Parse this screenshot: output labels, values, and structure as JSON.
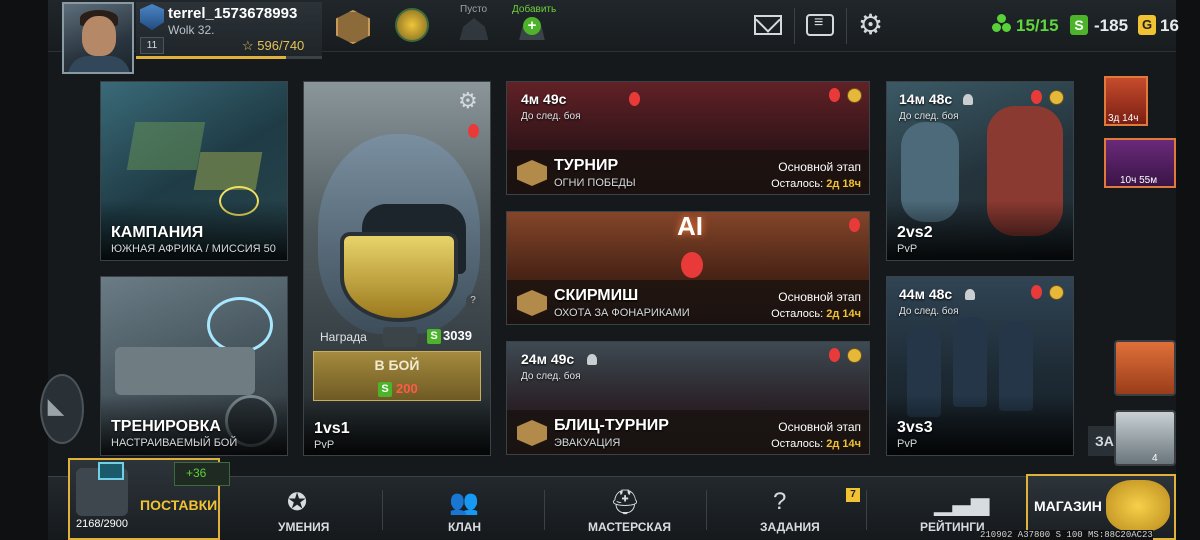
{
  "profile": {
    "username": "terrel_1573678993",
    "clan": "Wolk 32.",
    "level": "11",
    "xp": "596/740",
    "xp_fraction": 0.805
  },
  "top_slots": {
    "empty_label": "Пусто",
    "add_label": "Добавить"
  },
  "resources": {
    "energy": "15/15",
    "silver": "-185",
    "gold": "16",
    "silver_icon_letter": "S",
    "gold_icon_letter": "G"
  },
  "cards": {
    "campaign": {
      "title": "КАМПАНИЯ",
      "subtitle": "ЮЖНАЯ АФРИКА / МИССИЯ 50"
    },
    "training": {
      "title": "ТРЕНИРОВКА",
      "subtitle": "НАСТРАИВАЕМЫЙ БОЙ"
    },
    "duel": {
      "title": "1vs1",
      "subtitle": "PvP",
      "reward_label": "Награда",
      "reward_value": "3039",
      "battle_label": "В БОЙ",
      "battle_cost": "200",
      "silver_icon_letter": "S",
      "question": "?"
    },
    "tournament": {
      "timer": "4м 49с",
      "timer_sub": "До след. боя",
      "title": "ТУРНИР",
      "subtitle": "ОГНИ ПОБЕДЫ",
      "stage": "Основной этап",
      "remain_label": "Осталось:",
      "remain_value": "2д 18ч"
    },
    "skirmish": {
      "ai_label": "AI",
      "title": "СКИРМИШ",
      "subtitle": "ОХОТА ЗА ФОНАРИКАМИ",
      "stage": "Основной этап",
      "remain_label": "Осталось:",
      "remain_value": "2д 14ч"
    },
    "blitz": {
      "timer": "24м 49с",
      "timer_sub": "До след. боя",
      "title": "БЛИЦ-ТУРНИР",
      "subtitle": "ЭВАКУАЦИЯ",
      "stage": "Основной этап",
      "remain_label": "Осталось:",
      "remain_value": "2д 14ч"
    },
    "pvp2": {
      "timer": "14м 48с",
      "timer_sub": "До след. боя",
      "title": "2vs2",
      "subtitle": "PvP"
    },
    "pvp3": {
      "timer": "44м 48с",
      "timer_sub": "До след. боя",
      "title": "3vs3",
      "subtitle": "PvP"
    }
  },
  "side": {
    "offer1_time": "3д 14ч",
    "offer2_time": "10ч 55м",
    "crate_count": "4",
    "partial_label": "ЗА"
  },
  "bottom_nav": {
    "supplies_label": "ПОСТАВКИ",
    "supplies_count": "2168/2900",
    "supplies_bonus": "+36",
    "skills": "УМЕНИЯ",
    "clan": "КЛАН",
    "workshop": "МАСТЕРСКАЯ",
    "tasks": "ЗАДАНИЯ",
    "tasks_badge": "7",
    "ratings": "РЕЙТИНГИ",
    "shop": "МАГАЗИН"
  },
  "debug_text": "210902 A37800 S 100 MS:88C20AC23"
}
